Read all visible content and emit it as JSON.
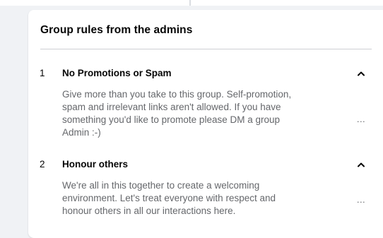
{
  "panel": {
    "title": "Group rules from the admins"
  },
  "rules": [
    {
      "number": "1",
      "title": "No Promotions or Spam",
      "description": "Give more than you take to this group. Self-promotion, spam and irrelevant links aren't allowed. If you have something you'd like to promote please DM a group Admin :-)",
      "more": "..."
    },
    {
      "number": "2",
      "title": "Honour others",
      "description": "We're all in this together to create a welcoming environment. Let's treat everyone with respect and honour others in all our interactions here.",
      "more": "..."
    }
  ],
  "icons": {
    "collapse": "chevron-up-icon",
    "more": "more-options-icon"
  },
  "colors": {
    "background": "#f0f2f5",
    "card": "#ffffff",
    "primary_text": "#050505",
    "secondary_text": "#65676b",
    "separator": "#ced0d4"
  }
}
